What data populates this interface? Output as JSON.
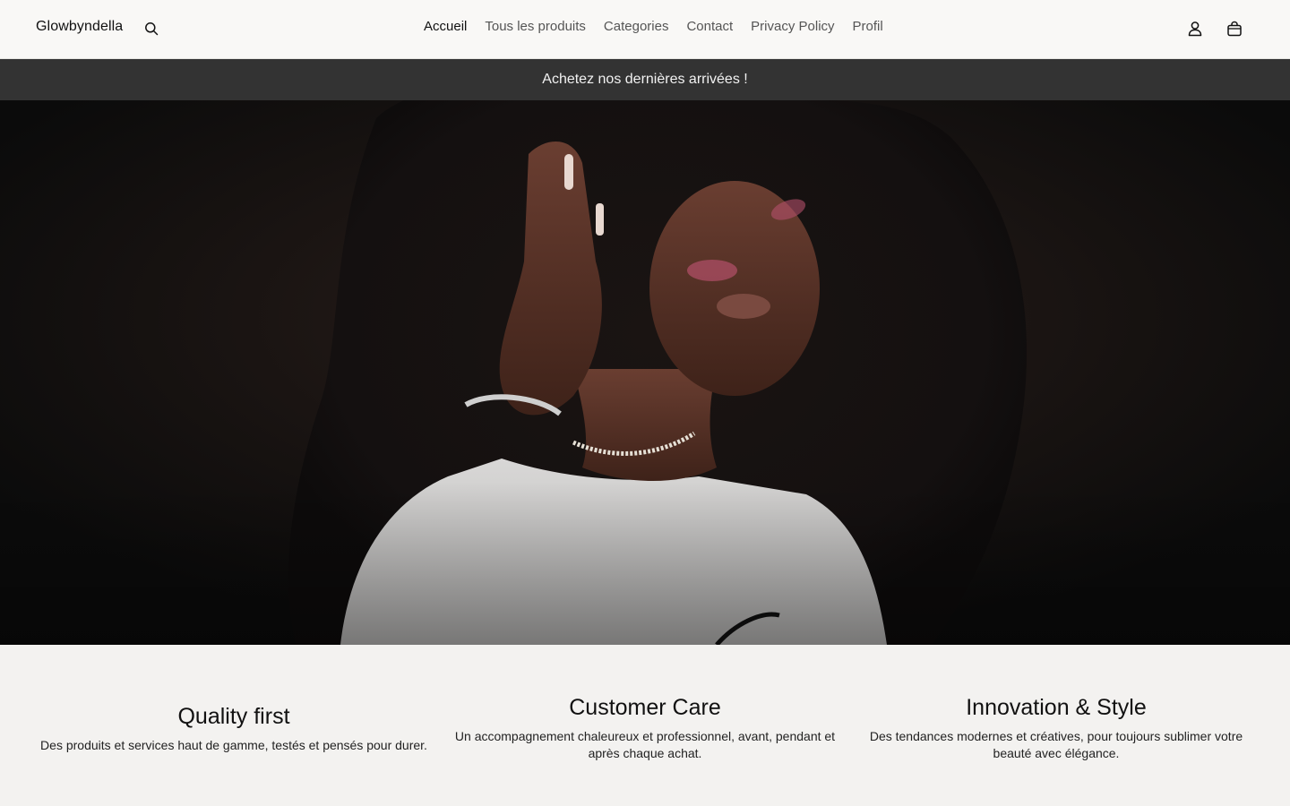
{
  "header": {
    "brand": "Glowbyndella",
    "search_icon": "search-icon",
    "nav": [
      {
        "label": "Accueil",
        "active": true
      },
      {
        "label": "Tous les produits",
        "active": false
      },
      {
        "label": "Categories",
        "active": false
      },
      {
        "label": "Contact",
        "active": false
      },
      {
        "label": "Privacy Policy",
        "active": false
      },
      {
        "label": "Profil",
        "active": false
      }
    ],
    "account_icon": "user-icon",
    "cart_icon": "shopping-bag-icon"
  },
  "announcement": {
    "text": "Achetez nos dernières arrivées !"
  },
  "hero": {
    "image": "portrait-woman-curly-hair"
  },
  "features": [
    {
      "title": "Quality first",
      "text": "Des produits et services haut de gamme, testés et pensés pour durer."
    },
    {
      "title": "Customer Care",
      "text": "Un accompagnement chaleureux et professionnel, avant, pendant et après chaque achat."
    },
    {
      "title": "Innovation & Style",
      "text": "Des tendances modernes et créatives, pour toujours sublimer votre beauté avec élégance."
    }
  ],
  "colors": {
    "header_bg": "#f9f8f6",
    "announcement_bg": "#333333",
    "hero_bg": "#0b0b0b",
    "features_bg": "#f3f2f0"
  }
}
